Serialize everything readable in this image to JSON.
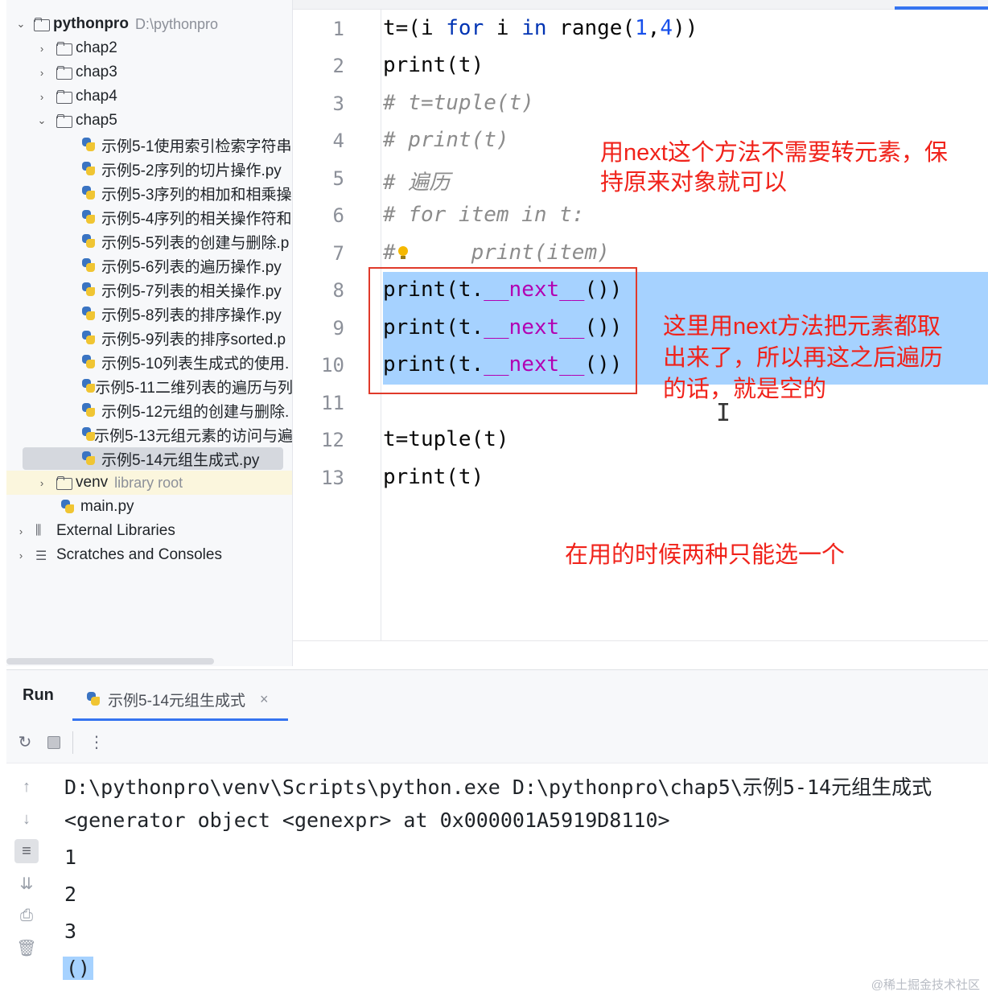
{
  "project": {
    "root": {
      "name": "pythonpro",
      "path": "D:\\pythonpro"
    },
    "folders": [
      "chap2",
      "chap3",
      "chap4",
      "chap5"
    ],
    "chap5_files": [
      "示例5-1使用索引检索字符串",
      "示例5-2序列的切片操作.py",
      "示例5-3序列的相加和相乘操",
      "示例5-4序列的相关操作符和",
      "示例5-5列表的创建与删除.p",
      "示例5-6列表的遍历操作.py",
      "示例5-7列表的相关操作.py",
      "示例5-8列表的排序操作.py",
      "示例5-9列表的排序sorted.p",
      "示例5-10列表生成式的使用.",
      "示例5-11二维列表的遍历与列",
      "示例5-12元组的创建与删除.",
      "示例5-13元组元素的访问与遍",
      "示例5-14元组生成式.py"
    ],
    "venv": {
      "name": "venv",
      "note": "library root"
    },
    "main_file": "main.py",
    "external_libraries": "External Libraries",
    "scratches": "Scratches and Consoles"
  },
  "editor": {
    "line_numbers": [
      "1",
      "2",
      "3",
      "4",
      "5",
      "6",
      "7",
      "8",
      "9",
      "10",
      "11",
      "12",
      "13"
    ],
    "annotations": {
      "top": "用next这个方法不需要转元素，保持原来对象就可以",
      "top_line1": "用next这个方法不需要转元素，保",
      "top_line2": "持原来对象就可以",
      "middle_line1": "这里用next方法把元素都取",
      "middle_line2": "出来了，所以再这之后遍历",
      "middle_line3": "的话，就是空的",
      "bottom": "在用的时候两种只能选一个"
    }
  },
  "run": {
    "title": "Run",
    "tab_label": "示例5-14元组生成式",
    "console_lines": [
      "D:\\pythonpro\\venv\\Scripts\\python.exe D:\\pythonpro\\chap5\\示例5-14元组生成式",
      "<generator object <genexpr> at 0x000001A5919D8110>",
      "1",
      "2",
      "3",
      "()"
    ]
  },
  "watermark": "@稀土掘金技术社区",
  "icons": {
    "rerun": "rerun-icon",
    "stop": "stop-icon",
    "more": "more-icon",
    "up": "arrow-up-icon",
    "down": "arrow-down-icon",
    "wrap": "soft-wrap-icon",
    "scroll_end": "scroll-to-end-icon",
    "print": "print-icon",
    "trash": "trash-icon"
  },
  "colors": {
    "selection": "#a6d2ff",
    "annotation": "#f0221a",
    "keyword": "#0033b3",
    "number": "#1750eb",
    "dunder": "#b200b2"
  }
}
